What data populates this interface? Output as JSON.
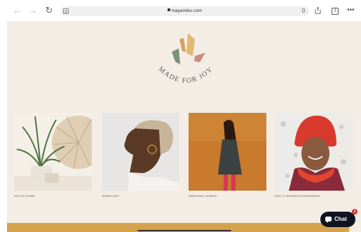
{
  "browser": {
    "url": "mayamiku.com",
    "back_icon": "←",
    "forward_icon": "→",
    "reload_icon": "↻",
    "tabs_count": "3",
    "more_icon": "•••"
  },
  "brand": {
    "name": "MADE FOR JOY",
    "mark_colors": [
      "#7c8f7c",
      "#e2b873",
      "#c98f7e",
      "#d7a25f"
    ]
  },
  "products": [
    {
      "label": "OFFICE HOME"
    },
    {
      "label": "JEWELLERY"
    },
    {
      "label": "DRESSING GOWNS"
    },
    {
      "label": "KNIT & WINTER ACCESSORIES"
    }
  ],
  "chat": {
    "label": "Chat",
    "badge": "1"
  },
  "colors": {
    "page_background": "#f3ede5",
    "footer_band": "#d6a34c",
    "chat_background": "#101420"
  }
}
